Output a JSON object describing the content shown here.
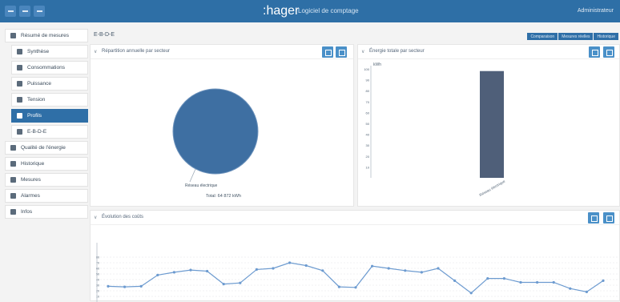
{
  "app": {
    "brand": ":hager",
    "tagline": "Logiciel de comptage",
    "account": "Administrateur"
  },
  "sidebar": {
    "items": [
      {
        "label": "Résumé de mesures",
        "level": 0,
        "active": false,
        "icon": "meter-icon"
      },
      {
        "label": "Synthèse",
        "level": 1,
        "active": false,
        "icon": "dot-icon"
      },
      {
        "label": "Consommations",
        "level": 1,
        "active": false,
        "icon": "grid-icon"
      },
      {
        "label": "Puissance",
        "level": 1,
        "active": false,
        "icon": "dollar-icon"
      },
      {
        "label": "Tension",
        "level": 1,
        "active": false,
        "icon": "plug-icon"
      },
      {
        "label": "Profils",
        "level": 1,
        "active": true,
        "icon": "dollar-icon"
      },
      {
        "label": "E-B-D-E",
        "level": 1,
        "active": false,
        "icon": "gear-icon"
      },
      {
        "label": "Qualité de l'énergie",
        "level": 0,
        "active": false,
        "icon": "tool-icon"
      },
      {
        "label": "Historique",
        "level": 0,
        "active": false,
        "icon": "clock-icon"
      },
      {
        "label": "Mesures",
        "level": 0,
        "active": false,
        "icon": "chart-icon"
      },
      {
        "label": "Alarmes",
        "level": 0,
        "active": false,
        "icon": "bell-icon"
      },
      {
        "label": "Infos",
        "level": 0,
        "active": false,
        "icon": "info-icon"
      }
    ]
  },
  "breadcrumb": "E-B-D-E",
  "tabs": [
    "Comparaison",
    "Mesures réelles",
    "Historique"
  ],
  "panels": {
    "pie_title": "Répartition annuelle par secteur",
    "bar_title": "Énergie totale par secteur",
    "line_title": "Évolution des coûts"
  },
  "chart_data": [
    {
      "type": "pie",
      "title": "",
      "slices": [
        {
          "label": "Réseau électrique",
          "value": 100
        }
      ],
      "footer": "Total: 64 872 kWh",
      "colors": [
        "#3e6fa2"
      ]
    },
    {
      "type": "bar",
      "categories": [
        "Réseau électrique"
      ],
      "values": [
        98
      ],
      "ylabel": "kWh",
      "ylim": [
        0,
        100
      ],
      "yticks": [
        10,
        20,
        30,
        40,
        50,
        60,
        70,
        80,
        90,
        100
      ],
      "colors": [
        "#4f5f79"
      ]
    },
    {
      "type": "line",
      "title": "",
      "ylim": [
        0,
        100
      ],
      "yticks": [
        10,
        20,
        30,
        40,
        50,
        60,
        70,
        80
      ],
      "values": [
        28,
        27,
        28,
        48,
        53,
        57,
        55,
        32,
        34,
        58,
        60,
        70,
        65,
        56,
        27,
        26,
        64,
        60,
        56,
        53,
        60,
        38,
        16,
        42,
        42,
        35,
        35,
        35,
        24,
        18,
        38
      ],
      "colors": [
        "#6d9bd0"
      ]
    }
  ]
}
